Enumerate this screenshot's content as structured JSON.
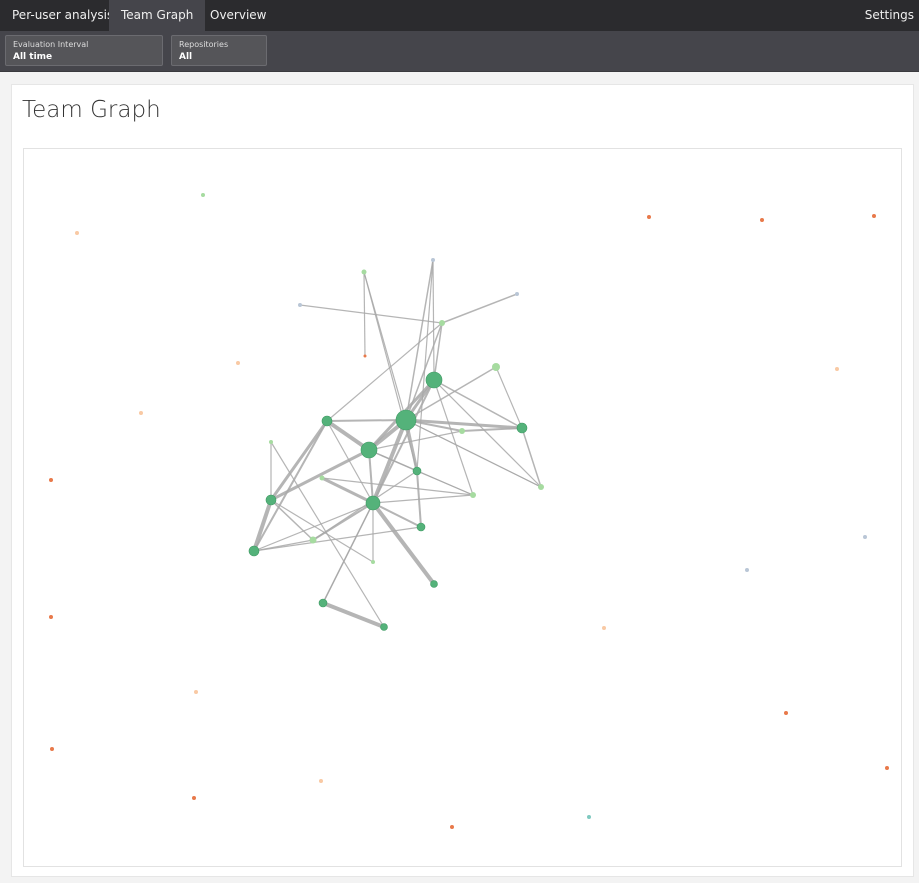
{
  "nav": {
    "tabs": [
      {
        "label": "Per-user analysis",
        "active": false
      },
      {
        "label": "Team Graph",
        "active": true
      },
      {
        "label": "Overview",
        "active": false
      }
    ],
    "settings_label": "Settings"
  },
  "filters": [
    {
      "label": "Evaluation Interval",
      "value": "All time"
    },
    {
      "label": "Repositories",
      "value": "All"
    }
  ],
  "page": {
    "title": "Team Graph"
  },
  "colors": {
    "node_green": "#54b27a",
    "node_light_green": "#a6dba0",
    "node_orange": "#e8794a",
    "node_light_orange": "#f9c9a4",
    "edge": "#a8a8a8"
  }
}
